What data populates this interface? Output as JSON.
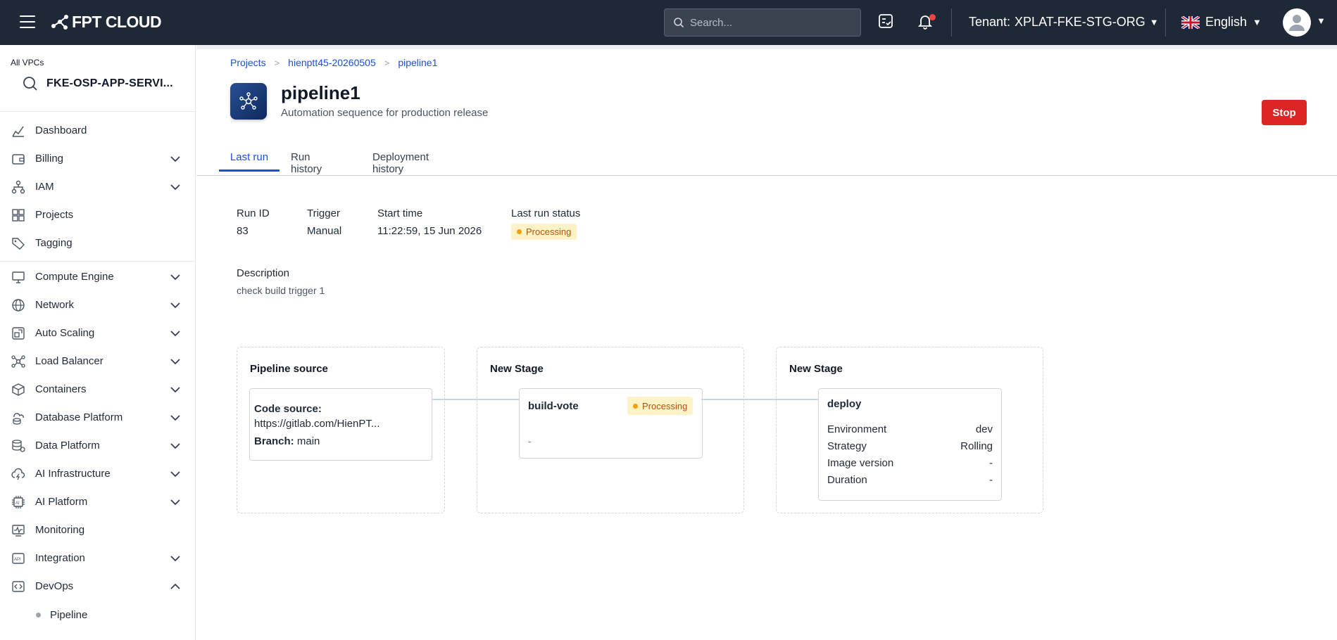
{
  "header": {
    "logo_text": "FPT CLOUD",
    "search_placeholder": "Search...",
    "tenant_label": "Tenant:",
    "tenant_name": "XPLAT-FKE-STG-ORG",
    "language": "English"
  },
  "sidebar": {
    "vpc_label": "All VPCs",
    "vpc_name": "FKE-OSP-APP-SERVI...",
    "items": [
      {
        "label": "Dashboard",
        "icon": "chart-icon",
        "expandable": false
      },
      {
        "label": "Billing",
        "icon": "wallet-icon",
        "expandable": true
      },
      {
        "label": "IAM",
        "icon": "org-chart-icon",
        "expandable": true
      },
      {
        "label": "Projects",
        "icon": "blocks-icon",
        "expandable": false
      },
      {
        "label": "Tagging",
        "icon": "tag-icon",
        "expandable": false
      },
      {
        "label": "Compute Engine",
        "icon": "monitor-icon",
        "expandable": true
      },
      {
        "label": "Network",
        "icon": "globe-icon",
        "expandable": true
      },
      {
        "label": "Auto Scaling",
        "icon": "scaling-icon",
        "expandable": true
      },
      {
        "label": "Load Balancer",
        "icon": "network-nodes-icon",
        "expandable": true
      },
      {
        "label": "Containers",
        "icon": "box-icon",
        "expandable": true
      },
      {
        "label": "Database Platform",
        "icon": "cloud-db-icon",
        "expandable": true
      },
      {
        "label": "Data Platform",
        "icon": "database-icon",
        "expandable": true
      },
      {
        "label": "AI Infrastructure",
        "icon": "cloud-bolt-icon",
        "expandable": true
      },
      {
        "label": "AI Platform",
        "icon": "ai-chip-icon",
        "expandable": true
      },
      {
        "label": "Monitoring",
        "icon": "pulse-icon",
        "expandable": false
      },
      {
        "label": "Integration",
        "icon": "api-icon",
        "expandable": true
      },
      {
        "label": "DevOps",
        "icon": "code-window-icon",
        "expandable": true,
        "expanded": true
      }
    ],
    "devops_sub": [
      {
        "label": "Pipeline"
      }
    ]
  },
  "breadcrumb": [
    "Projects",
    "hienptt45-20260505",
    "pipeline1"
  ],
  "page": {
    "title": "pipeline1",
    "subtitle": "Automation sequence for production release",
    "stop_label": "Stop"
  },
  "tabs": [
    "Last run",
    "Run history",
    "Deployment history"
  ],
  "run": {
    "run_id_label": "Run ID",
    "run_id": "83",
    "trigger_label": "Trigger",
    "trigger": "Manual",
    "start_time_label": "Start time",
    "start_time": "11:22:59, 15 Jun 2026",
    "status_label": "Last run status",
    "status": "Processing",
    "description_label": "Description",
    "description": "check build trigger 1"
  },
  "pipeline": {
    "source": {
      "title": "Pipeline source",
      "code_source_label": "Code source:",
      "code_source_url": "https://gitlab.com/HienPT...",
      "branch_label": "Branch:",
      "branch": "main"
    },
    "stage1": {
      "title": "New Stage",
      "job_name": "build-vote",
      "job_status": "Processing",
      "job_detail": "-"
    },
    "stage2": {
      "title": "New Stage",
      "job_name": "deploy",
      "rows": [
        {
          "key": "Environment",
          "value": "dev"
        },
        {
          "key": "Strategy",
          "value": "Rolling"
        },
        {
          "key": "Image version",
          "value": "-"
        },
        {
          "key": "Duration",
          "value": "-"
        }
      ]
    }
  },
  "colors": {
    "topbar": "#1e2836",
    "accent": "#1d4ed8",
    "stop": "#dc2626",
    "processing_bg": "#fef3c7",
    "processing_text": "#b45309"
  }
}
